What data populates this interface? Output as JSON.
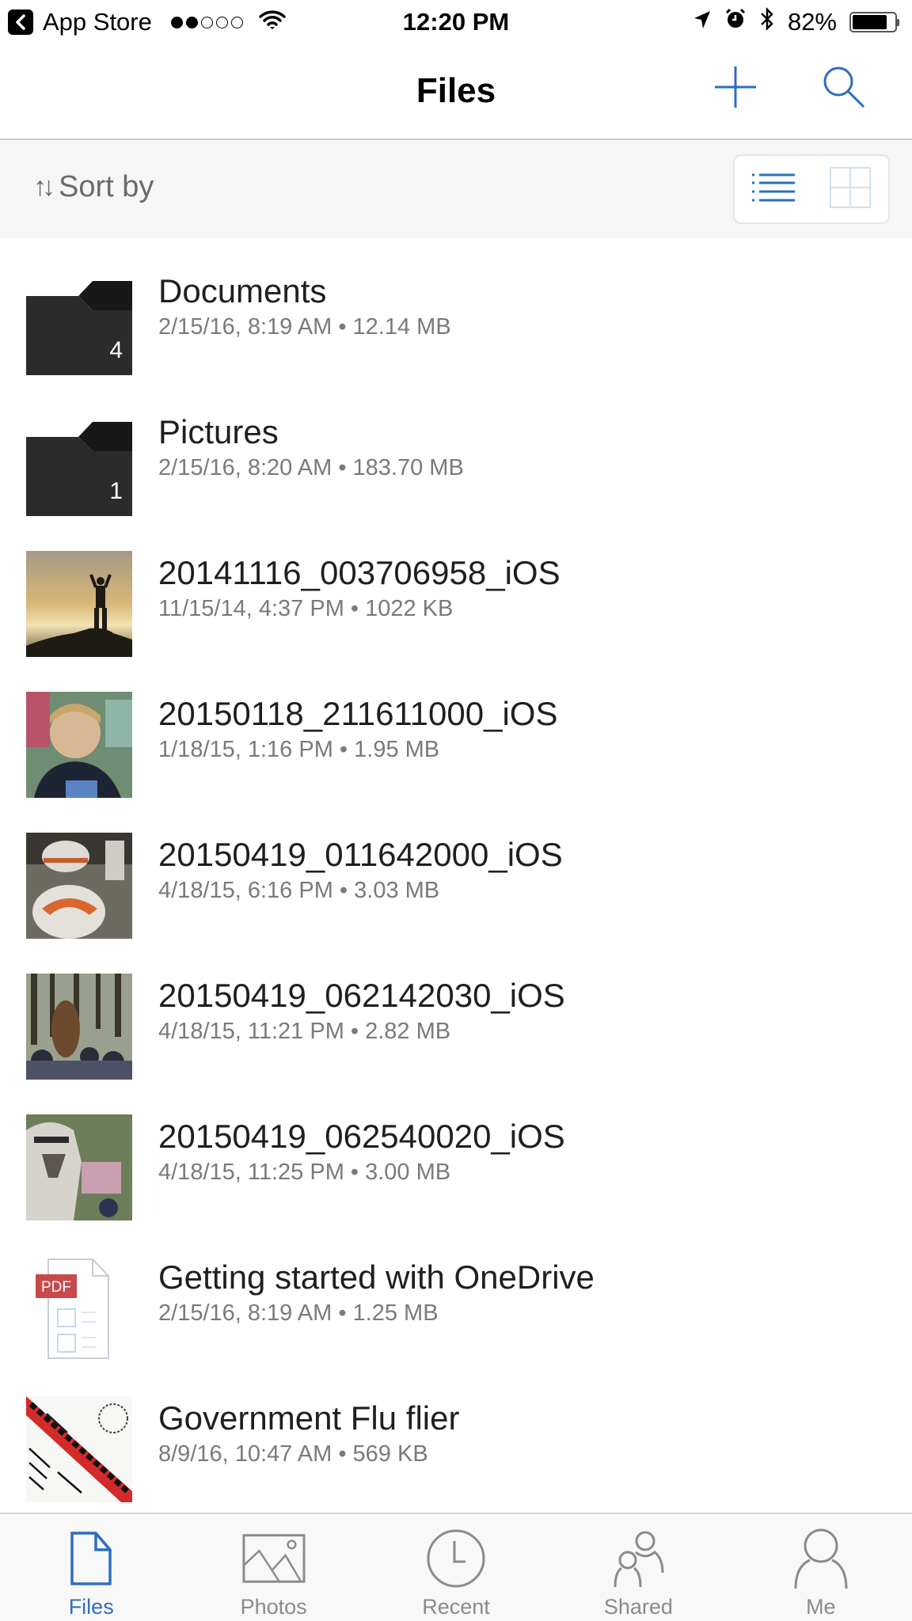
{
  "status_bar": {
    "back_app": "App Store",
    "signal_total": 5,
    "signal_on": 2,
    "time": "12:20 PM",
    "battery_text": "82%",
    "battery_level": 0.82
  },
  "nav": {
    "title": "Files",
    "add_icon": "plus-icon",
    "search_icon": "search-icon"
  },
  "sort": {
    "label": "Sort by",
    "arrows": "↑↓",
    "view_modes": [
      "list",
      "grid"
    ],
    "active_view": "list"
  },
  "colors": {
    "accent": "#2e6dbf",
    "inactive": "#8a8a8a",
    "folder": "#2b2b2b",
    "pdf_badge": "#c9494a"
  },
  "files": [
    {
      "name": "Documents",
      "meta": "2/15/16, 8:19 AM • 12.14 MB",
      "type": "folder",
      "count": "4"
    },
    {
      "name": "Pictures",
      "meta": "2/15/16, 8:20 AM • 183.70 MB",
      "type": "folder",
      "count": "1"
    },
    {
      "name": "20141116_003706958_iOS",
      "meta": "11/15/14, 4:37 PM • 1022 KB",
      "type": "photo",
      "thumb": "sunset-silhouette"
    },
    {
      "name": "20150118_211611000_iOS",
      "meta": "1/18/15, 1:16 PM • 1.95 MB",
      "type": "photo",
      "thumb": "child-portrait"
    },
    {
      "name": "20150419_011642000_iOS",
      "meta": "4/18/15, 6:16 PM • 3.03 MB",
      "type": "photo",
      "thumb": "droid-robot"
    },
    {
      "name": "20150419_062142030_iOS",
      "meta": "4/18/15, 11:21 PM • 2.82 MB",
      "type": "photo",
      "thumb": "crowd-trees"
    },
    {
      "name": "20150419_062540020_iOS",
      "meta": "4/18/15, 11:25 PM • 3.00 MB",
      "type": "photo",
      "thumb": "costume-trooper"
    },
    {
      "name": "Getting started with OneDrive",
      "meta": "2/15/16, 8:19 AM • 1.25 MB",
      "type": "pdf",
      "badge": "PDF"
    },
    {
      "name": "Government Flu flier",
      "meta": "8/9/16, 10:47 AM • 569 KB",
      "type": "image",
      "thumb": "flier-art"
    }
  ],
  "tabs": [
    {
      "label": "Files",
      "icon": "file-icon",
      "active": true
    },
    {
      "label": "Photos",
      "icon": "photos-icon",
      "active": false
    },
    {
      "label": "Recent",
      "icon": "clock-icon",
      "active": false
    },
    {
      "label": "Shared",
      "icon": "shared-people-icon",
      "active": false
    },
    {
      "label": "Me",
      "icon": "person-icon",
      "active": false
    }
  ]
}
